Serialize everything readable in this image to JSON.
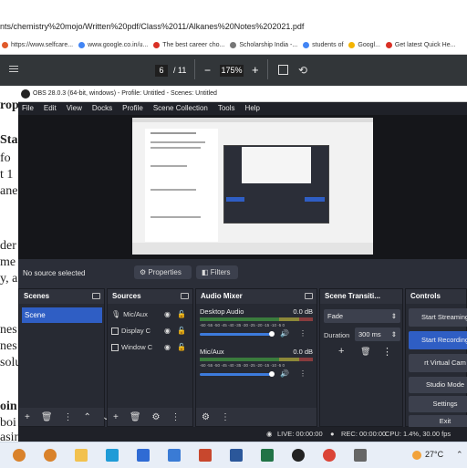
{
  "browser": {
    "url": "nts/chemistry%20mojo/Written%20pdf/Class%2011/Alkanes%20Notes%202021.pdf",
    "bookmarks": [
      {
        "label": "https://www.selfcare...",
        "color": "#e05a2a"
      },
      {
        "label": "www.google.co.in/u...",
        "color": "#4285f4"
      },
      {
        "label": "The best career cho...",
        "color": "#d93025"
      },
      {
        "label": "Scholarship India -...",
        "color": "#777777"
      },
      {
        "label": "students of",
        "color": "#4285f4"
      },
      {
        "label": "Googl...",
        "color": "#f4b400"
      },
      {
        "label": "Get latest Quick He...",
        "color": "#d93025"
      }
    ]
  },
  "pdf_toolbar": {
    "page": "6",
    "total": "/ 11",
    "minus": "−",
    "zoom": "175%",
    "plus": "+"
  },
  "pdf_fragments": [
    "rop",
    "Sta",
    "fo",
    "t 1",
    "anes",
    "der",
    "me",
    "y, a",
    "nes",
    "nes",
    "solu",
    "oin",
    "boi",
    "asing number of carbon atoms."
  ],
  "obs": {
    "title": "OBS 28.0.3 (64-bit, windows) - Profile: Untitled - Scenes: Untitled",
    "menu": [
      "File",
      "Edit",
      "View",
      "Docks",
      "Profile",
      "Scene Collection",
      "Tools",
      "Help"
    ],
    "no_source": "No source selected",
    "properties": "Properties",
    "filters": "Filters",
    "docks": {
      "scenes": {
        "title": "Scenes",
        "items": [
          "Scene"
        ]
      },
      "sources": {
        "title": "Sources",
        "items": [
          "Mic/Aux",
          "Display C",
          "Window C"
        ]
      },
      "mixer": {
        "title": "Audio Mixer",
        "channels": [
          {
            "name": "Desktop Audio",
            "db": "0.0 dB",
            "level": 0.85
          },
          {
            "name": "Mic/Aux",
            "db": "0.0 dB",
            "level": 0.85
          }
        ],
        "scale": "-60 -55 -50 -45 -40 -35 -30 -25 -20 -15 -10 -5 0"
      },
      "transitions": {
        "title": "Scene Transiti...",
        "type": "Fade",
        "duration_label": "Duration",
        "duration_value": "300 ms"
      },
      "controls": {
        "title": "Controls",
        "buttons": [
          "Start Streaming",
          "Start Recording",
          "rt Virtual Cam",
          "Studio Mode",
          "Settings",
          "Exit"
        ]
      }
    },
    "status": {
      "live": "LIVE: 00:00:00",
      "rec": "REC: 00:00:00",
      "cpu": "CPU: 1.4%, 30.00 fps"
    }
  },
  "taskbar": {
    "temperature": "27°C",
    "apps": [
      {
        "name": "lamp-app",
        "color": "#d9822b"
      },
      {
        "name": "lamp-app-2",
        "color": "#d9822b"
      },
      {
        "name": "file-explorer",
        "color": "#f2c14e"
      },
      {
        "name": "edge",
        "color": "#1f9bd7"
      },
      {
        "name": "photos",
        "color": "#2f6bd4"
      },
      {
        "name": "media",
        "color": "#3a7bd5"
      },
      {
        "name": "powerpoint",
        "color": "#c8472d"
      },
      {
        "name": "word",
        "color": "#2b579a"
      },
      {
        "name": "excel",
        "color": "#217346"
      },
      {
        "name": "obs",
        "color": "#222222"
      },
      {
        "name": "chrome",
        "color": "#db4437"
      },
      {
        "name": "settings",
        "color": "#666666"
      }
    ]
  }
}
